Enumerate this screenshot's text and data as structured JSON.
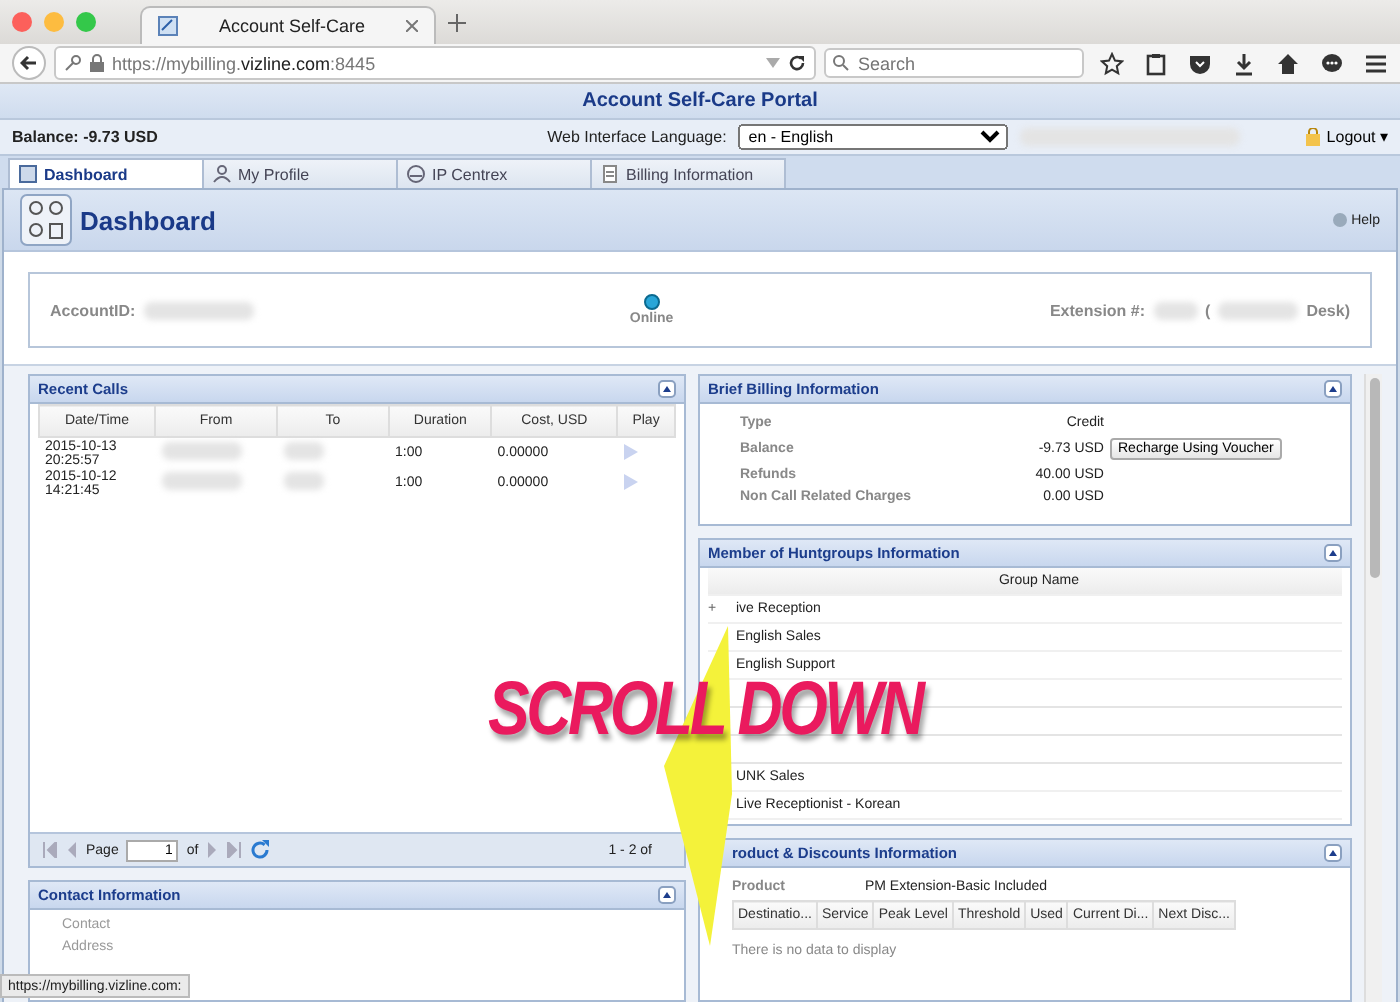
{
  "browser": {
    "tab_title": "Account Self-Care",
    "url_host": "https://mybilling.",
    "url_domain": "vizline.com",
    "url_port": ":8445",
    "search_placeholder": "Search",
    "status_url": "https://mybilling.vizline.com:"
  },
  "portal": {
    "title": "Account Self-Care Portal",
    "balance": "Balance: -9.73 USD",
    "language_label": "Web Interface Language:",
    "language_value": "en - English",
    "logout": "Logout",
    "logout_caret": "▾"
  },
  "tabs": [
    {
      "label": "Dashboard",
      "selected": true
    },
    {
      "label": "My Profile",
      "selected": false
    },
    {
      "label": "IP Centrex",
      "selected": false
    },
    {
      "label": "Billing Information",
      "selected": false
    }
  ],
  "header": {
    "title": "Dashboard",
    "help": "Help"
  },
  "status": {
    "account_label": "AccountID:",
    "state": "Online",
    "extension_label": "Extension #:",
    "paren": "(",
    "desk": "Desk)"
  },
  "recent_calls": {
    "title": "Recent Calls",
    "columns": [
      "Date/Time",
      "From",
      "To",
      "Duration",
      "Cost, USD",
      "Play"
    ],
    "rows": [
      {
        "datetime": "2015-10-13 20:25:57",
        "duration": "1:00",
        "cost": "0.00000"
      },
      {
        "datetime": "2015-10-12 14:21:45",
        "duration": "1:00",
        "cost": "0.00000"
      }
    ],
    "pager": {
      "page_label": "Page",
      "page_value": "1",
      "of_label": "of",
      "range": "1 - 2 of"
    }
  },
  "contact": {
    "title": "Contact Information",
    "fields": [
      "Contact",
      "Address"
    ]
  },
  "billing": {
    "title": "Brief Billing Information",
    "rows": [
      {
        "label": "Type",
        "value": "Credit"
      },
      {
        "label": "Balance",
        "value": "-9.73 USD",
        "action": "Recharge Using Voucher"
      },
      {
        "label": "Refunds",
        "value": "40.00 USD"
      },
      {
        "label": "Non Call Related Charges",
        "value": "0.00 USD"
      }
    ]
  },
  "huntgroups": {
    "title": "Member of Huntgroups Information",
    "column": "Group Name",
    "expander": "+",
    "rows": [
      {
        "kind": "group",
        "name": "ive Reception"
      },
      {
        "kind": "group",
        "name": "English Sales"
      },
      {
        "kind": "group",
        "name": "English Support"
      },
      {
        "kind": "covered"
      },
      {
        "kind": "covered"
      },
      {
        "kind": "covered"
      },
      {
        "kind": "group",
        "name": "UNK Sales"
      },
      {
        "kind": "group",
        "name": "Live Receptionist - Korean"
      }
    ]
  },
  "products": {
    "title": "roduct & Discounts Information",
    "product_label": "Product",
    "product_value": "PM Extension-Basic Included",
    "columns": [
      "Destinatio...",
      "Service",
      "Peak Level",
      "Threshold",
      "Used",
      "Current Di...",
      "Next Disc..."
    ],
    "empty": "There is no data to display"
  },
  "overlay": {
    "text": "SCROLL DOWN"
  }
}
